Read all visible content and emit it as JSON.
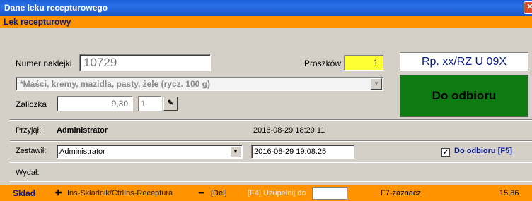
{
  "window": {
    "title": "Dane leku recepturowego"
  },
  "section": {
    "title": "Lek recepturowy"
  },
  "form": {
    "numer_label": "Numer naklejki",
    "numer_value": "10729",
    "proszkow_label": "Proszków",
    "proszkow_value": "1",
    "category_value": "*Maści, kremy, mazidła, pasty, żele (rycz. 100 g)",
    "zaliczka_label": "Zaliczka",
    "zaliczka_value": "9,30",
    "small_value": "1"
  },
  "rp": {
    "code": "Rp. xx/RZ U 09X"
  },
  "status": {
    "label": "Do odbioru",
    "color": "#0e7a12"
  },
  "przyjal": {
    "label": "Przyjął:",
    "user": "Administrator",
    "datetime": "2016-08-29 18:29:11"
  },
  "zestawil": {
    "label": "Zestawił:",
    "user": "Administrator",
    "datetime": "2016-08-29 19:08:25",
    "checkbox_label": "Do odbioru [F5]",
    "checked": true
  },
  "wydal": {
    "label": "Wydał:"
  },
  "bottom": {
    "sklad": "Skład",
    "ins": "Ins-Składnik/CtrlIns-Receptura",
    "del": "[Del]",
    "f4": "[F4] Uzupełnij do",
    "f7": "F7-zaznacz",
    "total": "15,86"
  },
  "colors": {
    "accent_orange": "#ff9400",
    "title_blue": "#1c5fd8",
    "status_green": "#0e7a12",
    "highlight_yellow": "#ffff33"
  }
}
